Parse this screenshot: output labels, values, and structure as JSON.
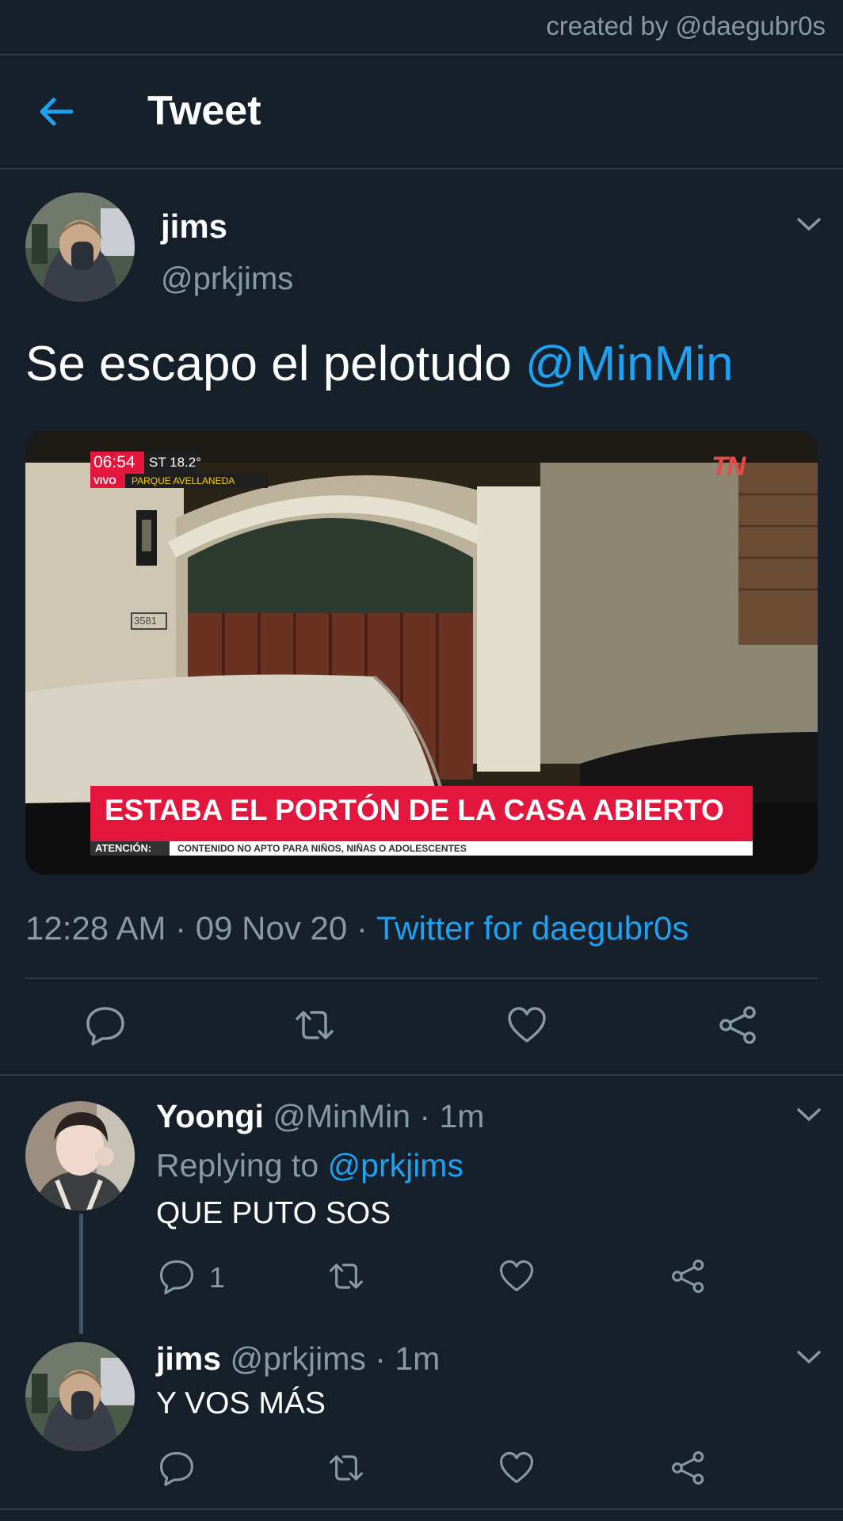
{
  "credit": "created by @daegubr0s",
  "header": {
    "title": "Tweet",
    "back_icon": "arrow-left-icon"
  },
  "main_tweet": {
    "author_name": "jims",
    "author_handle": "@prkjims",
    "text": "Se escapo el pelotudo ",
    "mention": "@MinMin",
    "media": {
      "time": "06:54",
      "temp": "ST 18.2°",
      "live": "VIVO",
      "location": "PARQUE AVELLANEDA",
      "house_number": "3581",
      "channel_logo": "TN",
      "headline": "ESTABA EL PORTÓN DE LA CASA ABIERTO",
      "warning_label": "ATENCIÓN:",
      "warning_text": "CONTENIDO NO APTO PARA NIÑOS, NIÑAS O ADOLESCENTES"
    },
    "timestamp": "12:28 AM · 09 Nov 20 · ",
    "source": "Twitter for daegubr0s"
  },
  "replies": [
    {
      "author_name": "Yoongi",
      "author_handle": "@MinMin",
      "time": " · 1m",
      "replying_label": "Replying to ",
      "replying_handle": "@prkjims",
      "text": "QUE PUTO SOS",
      "reply_count": "1"
    },
    {
      "author_name": "jims",
      "author_handle": "@prkjims",
      "time": " · 1m",
      "text": "Y VOS MÁS"
    }
  ],
  "colors": {
    "background": "#15202b",
    "accent": "#1da1f2",
    "muted": "#8899a6",
    "divider": "#2f3b47",
    "headline_bar": "#e3173e"
  }
}
